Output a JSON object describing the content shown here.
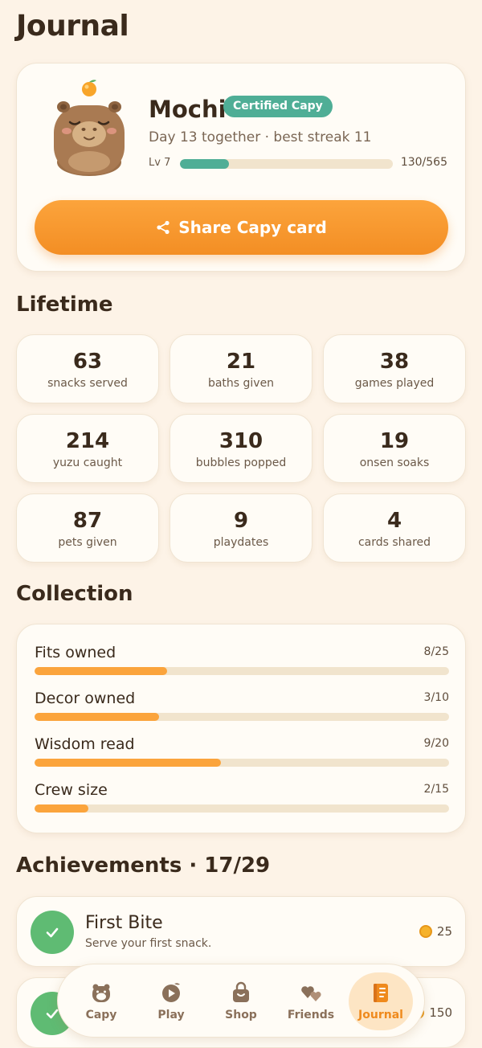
{
  "page": {
    "title": "Journal"
  },
  "profile": {
    "name": "Mochi",
    "badge": "Certified Capy",
    "day_line": "Day 13 together · best streak 11",
    "level_label": "Lv 7",
    "xp_text": "130/565",
    "xp_fraction": 0.23,
    "share_label": "Share Capy card"
  },
  "lifetime": {
    "title": "Lifetime",
    "stats": [
      {
        "value": "63",
        "label": "snacks served"
      },
      {
        "value": "21",
        "label": "baths given"
      },
      {
        "value": "38",
        "label": "games played"
      },
      {
        "value": "214",
        "label": "yuzu caught"
      },
      {
        "value": "310",
        "label": "bubbles popped"
      },
      {
        "value": "19",
        "label": "onsen soaks"
      },
      {
        "value": "87",
        "label": "pets given"
      },
      {
        "value": "9",
        "label": "playdates"
      },
      {
        "value": "4",
        "label": "cards shared"
      }
    ]
  },
  "collection": {
    "title": "Collection",
    "items": [
      {
        "label": "Fits owned",
        "count": "8/25",
        "fraction": 0.32
      },
      {
        "label": "Decor owned",
        "count": "3/10",
        "fraction": 0.3
      },
      {
        "label": "Wisdom read",
        "count": "9/20",
        "fraction": 0.45
      },
      {
        "label": "Crew size",
        "count": "2/15",
        "fraction": 0.13
      }
    ]
  },
  "achievements": {
    "title": "Achievements · 17/29",
    "items": [
      {
        "title": "First Bite",
        "desc": "Serve your first snack.",
        "reward": "25"
      },
      {
        "title": "",
        "desc": "",
        "reward": "150"
      }
    ]
  },
  "nav": {
    "items": [
      {
        "label": "Capy",
        "icon": "capy-icon"
      },
      {
        "label": "Play",
        "icon": "play-icon"
      },
      {
        "label": "Shop",
        "icon": "shop-icon"
      },
      {
        "label": "Friends",
        "icon": "friends-icon"
      },
      {
        "label": "Journal",
        "icon": "journal-icon"
      }
    ],
    "active": "Journal"
  },
  "colors": {
    "background": "#fdf3e7",
    "accent": "#f79a2e",
    "teal": "#4fae96",
    "success": "#5fbb73"
  }
}
